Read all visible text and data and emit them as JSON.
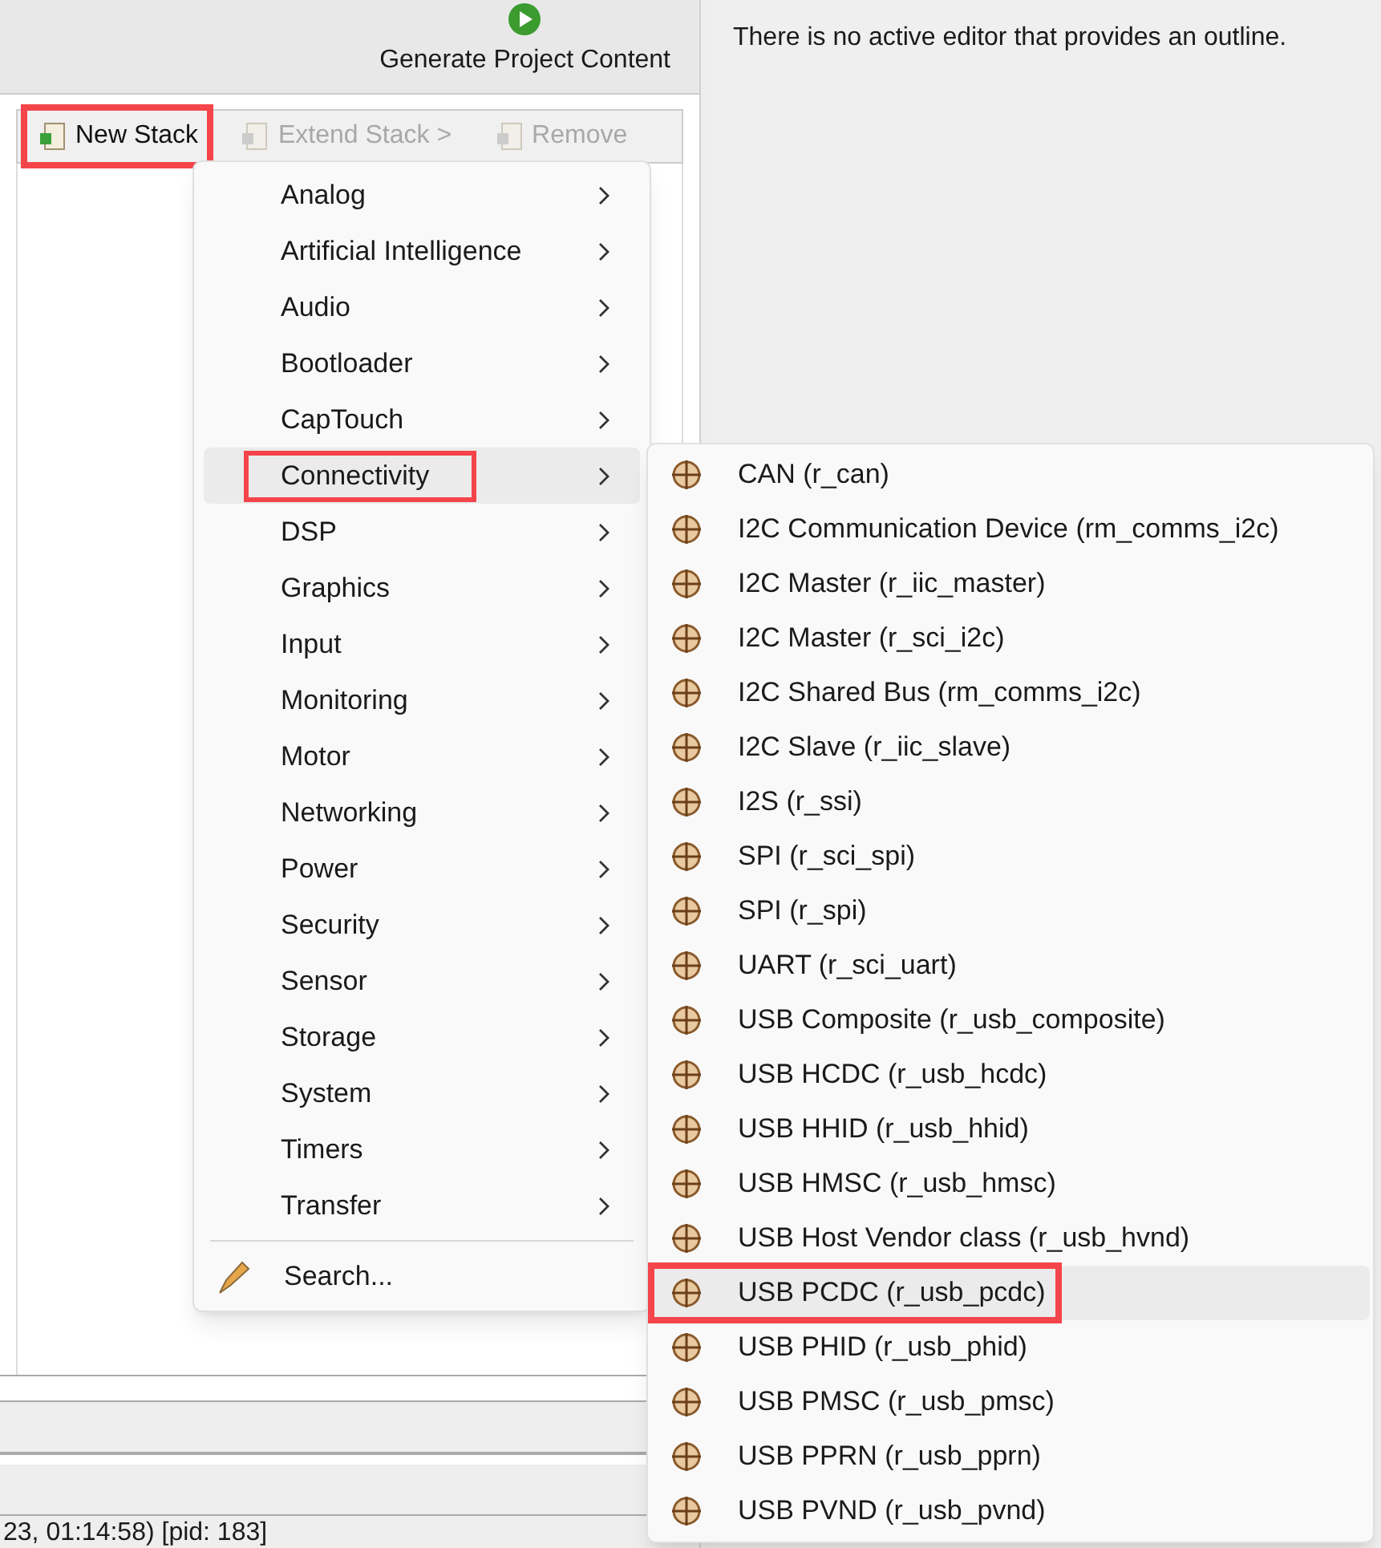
{
  "toolbar": {
    "generate_button": "Generate Project Content"
  },
  "stack_toolbar": [
    {
      "label": "New Stack",
      "disabled": false,
      "highlighted": true
    },
    {
      "label": "Extend Stack >",
      "disabled": true,
      "highlighted": false
    },
    {
      "label": "Remove",
      "disabled": true,
      "highlighted": false
    }
  ],
  "outline": {
    "message": "There is no active editor that provides an outline."
  },
  "status_bar": "23, 01:14:58) [pid: 183]",
  "menu": {
    "items": [
      {
        "label": "Analog",
        "selected": false,
        "highlighted": false
      },
      {
        "label": "Artificial Intelligence",
        "selected": false,
        "highlighted": false
      },
      {
        "label": "Audio",
        "selected": false,
        "highlighted": false
      },
      {
        "label": "Bootloader",
        "selected": false,
        "highlighted": false
      },
      {
        "label": "CapTouch",
        "selected": false,
        "highlighted": false
      },
      {
        "label": "Connectivity",
        "selected": true,
        "highlighted": true
      },
      {
        "label": "DSP",
        "selected": false,
        "highlighted": false
      },
      {
        "label": "Graphics",
        "selected": false,
        "highlighted": false
      },
      {
        "label": "Input",
        "selected": false,
        "highlighted": false
      },
      {
        "label": "Monitoring",
        "selected": false,
        "highlighted": false
      },
      {
        "label": "Motor",
        "selected": false,
        "highlighted": false
      },
      {
        "label": "Networking",
        "selected": false,
        "highlighted": false
      },
      {
        "label": "Power",
        "selected": false,
        "highlighted": false
      },
      {
        "label": "Security",
        "selected": false,
        "highlighted": false
      },
      {
        "label": "Sensor",
        "selected": false,
        "highlighted": false
      },
      {
        "label": "Storage",
        "selected": false,
        "highlighted": false
      },
      {
        "label": "System",
        "selected": false,
        "highlighted": false
      },
      {
        "label": "Timers",
        "selected": false,
        "highlighted": false
      },
      {
        "label": "Transfer",
        "selected": false,
        "highlighted": false
      }
    ],
    "search": "Search..."
  },
  "submenu": [
    {
      "label": "CAN (r_can)",
      "selected": false,
      "highlighted": false
    },
    {
      "label": "I2C Communication Device (rm_comms_i2c)",
      "selected": false,
      "highlighted": false
    },
    {
      "label": "I2C Master (r_iic_master)",
      "selected": false,
      "highlighted": false
    },
    {
      "label": "I2C Master (r_sci_i2c)",
      "selected": false,
      "highlighted": false
    },
    {
      "label": "I2C Shared Bus (rm_comms_i2c)",
      "selected": false,
      "highlighted": false
    },
    {
      "label": "I2C Slave (r_iic_slave)",
      "selected": false,
      "highlighted": false
    },
    {
      "label": "I2S (r_ssi)",
      "selected": false,
      "highlighted": false
    },
    {
      "label": "SPI (r_sci_spi)",
      "selected": false,
      "highlighted": false
    },
    {
      "label": "SPI (r_spi)",
      "selected": false,
      "highlighted": false
    },
    {
      "label": "UART (r_sci_uart)",
      "selected": false,
      "highlighted": false
    },
    {
      "label": "USB Composite (r_usb_composite)",
      "selected": false,
      "highlighted": false
    },
    {
      "label": "USB HCDC (r_usb_hcdc)",
      "selected": false,
      "highlighted": false
    },
    {
      "label": "USB HHID (r_usb_hhid)",
      "selected": false,
      "highlighted": false
    },
    {
      "label": "USB HMSC (r_usb_hmsc)",
      "selected": false,
      "highlighted": false
    },
    {
      "label": "USB Host Vendor class (r_usb_hvnd)",
      "selected": false,
      "highlighted": false
    },
    {
      "label": "USB PCDC (r_usb_pcdc)",
      "selected": true,
      "highlighted": true
    },
    {
      "label": "USB PHID (r_usb_phid)",
      "selected": false,
      "highlighted": false
    },
    {
      "label": "USB PMSC (r_usb_pmsc)",
      "selected": false,
      "highlighted": false
    },
    {
      "label": "USB PPRN (r_usb_pprn)",
      "selected": false,
      "highlighted": false
    },
    {
      "label": "USB PVND (r_usb_pvnd)",
      "selected": false,
      "highlighted": false
    }
  ]
}
